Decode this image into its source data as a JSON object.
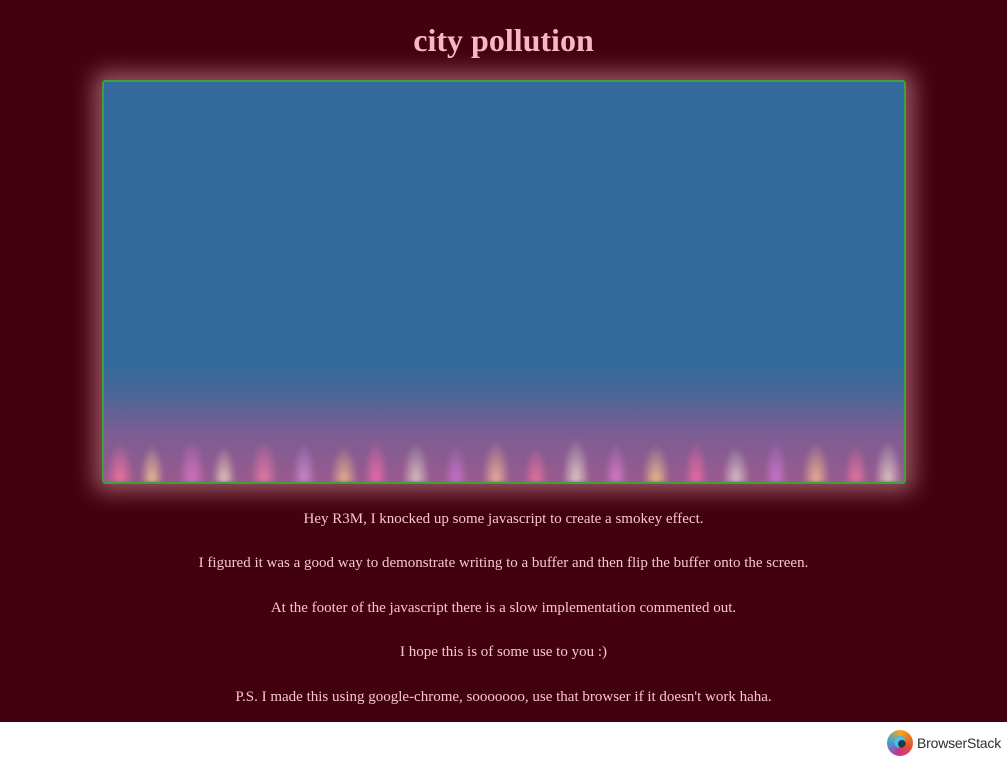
{
  "page": {
    "title": "city pollution"
  },
  "canvas": {
    "label": "smoke-canvas"
  },
  "messages": [
    "Hey R3M, I knocked up some javascript to create a smokey effect.",
    "I figured it was a good way to demonstrate writing to a buffer and then flip the buffer onto the screen.",
    "At the footer of the javascript there is a slow implementation commented out.",
    "I hope this is of some use to you :)",
    "P.S. I made this using google-chrome, sooooooo, use that browser if it doesn't work haha."
  ],
  "footer": {
    "brand_name": "BrowserStack",
    "brand_icon": "browserstack-logo-icon"
  },
  "colors": {
    "page_background": "#430010",
    "title_text": "#f5b8c0",
    "body_text": "#f5c6cc",
    "canvas_fill": "#336a9c",
    "canvas_border": "#3da13a"
  }
}
